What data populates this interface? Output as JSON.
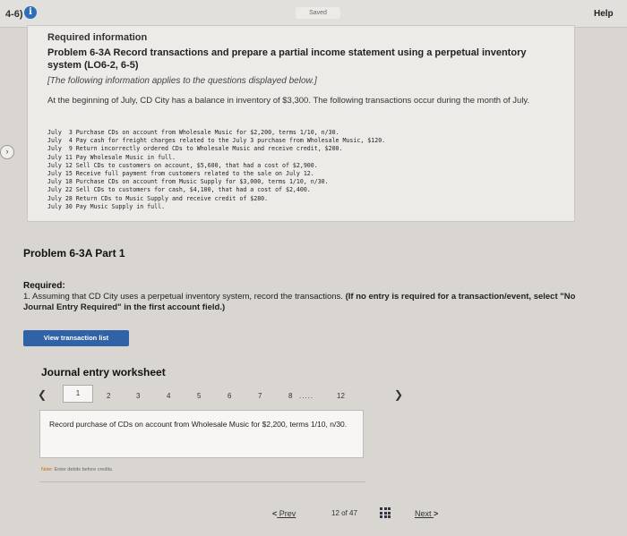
{
  "header": {
    "question_number": "4-6)",
    "info_icon": "i",
    "saved_label": "Saved",
    "help_label": "Help"
  },
  "problem": {
    "required_info": "Required information",
    "title": "Problem 6-3A Record transactions and prepare a partial income statement using a perpetual inventory system (LO6-2, 6-5)",
    "applies_note": "[The following information applies to the questions displayed below.]",
    "intro": "At the beginning of July, CD City has a balance in inventory of $3,300. The following transactions occur during the month of July.",
    "transactions": [
      "July  3 Purchase CDs on account from Wholesale Music for $2,200, terms 1/10, n/30.",
      "July  4 Pay cash for freight charges related to the July 3 purchase from Wholesale Music, $120.",
      "July  9 Return incorrectly ordered CDs to Wholesale Music and receive credit, $200.",
      "July 11 Pay Wholesale Music in full.",
      "July 12 Sell CDs to customers on account, $5,600, that had a cost of $2,900.",
      "July 15 Receive full payment from customers related to the sale on July 12.",
      "July 18 Purchase CDs on account from Music Supply for $3,000, terms 1/10, n/30.",
      "July 22 Sell CDs to customers for cash, $4,100, that had a cost of $2,400.",
      "July 28 Return CDs to Music Supply and receive credit of $280.",
      "July 30 Pay Music Supply in full."
    ]
  },
  "part": {
    "title": "Problem 6-3A Part 1",
    "required_heading": "Required:",
    "required_text": "1. Assuming that CD City uses a perpetual inventory system, record the transactions.",
    "required_bold": "(If no entry is required for a transaction/event, select \"No Journal Entry Required\" in the first account field.)",
    "view_button": "View transaction list"
  },
  "worksheet": {
    "title": "Journal entry worksheet",
    "pages": [
      "1",
      "2",
      "3",
      "4",
      "5",
      "6",
      "7",
      "8",
      ".....",
      "12"
    ],
    "entry_text": "Record purchase of CDs on account from Wholesale Music for $2,200, terms 1/10, n/30.",
    "note_prefix": "Note:",
    "note_text": "Enter debits before credits."
  },
  "navigation": {
    "prev_label": "Prev",
    "position": "12 of 47",
    "next_label": "Next"
  }
}
